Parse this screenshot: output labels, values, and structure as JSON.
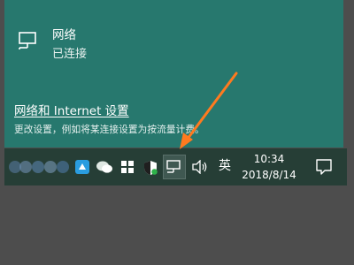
{
  "flyout": {
    "network_name": "网络",
    "network_status": "已连接",
    "settings_link": "网络和 Internet 设置",
    "settings_description": "更改设置，例如将某连接设置为按流量计费。"
  },
  "taskbar": {
    "input_method": "英",
    "clock_time": "10:34",
    "clock_date": "2018/8/14",
    "tray_icons": [
      "blurred-app-icons",
      "bird-app-icon",
      "wechat-icon",
      "flag-icon",
      "shield-icon",
      "network-icon",
      "volume-icon"
    ]
  },
  "colors": {
    "flyout_bg": "#27786e",
    "taskbar_bg": "#263e36",
    "desktop_bg": "#4d4d4d",
    "arrow": "#ff7a1f"
  }
}
